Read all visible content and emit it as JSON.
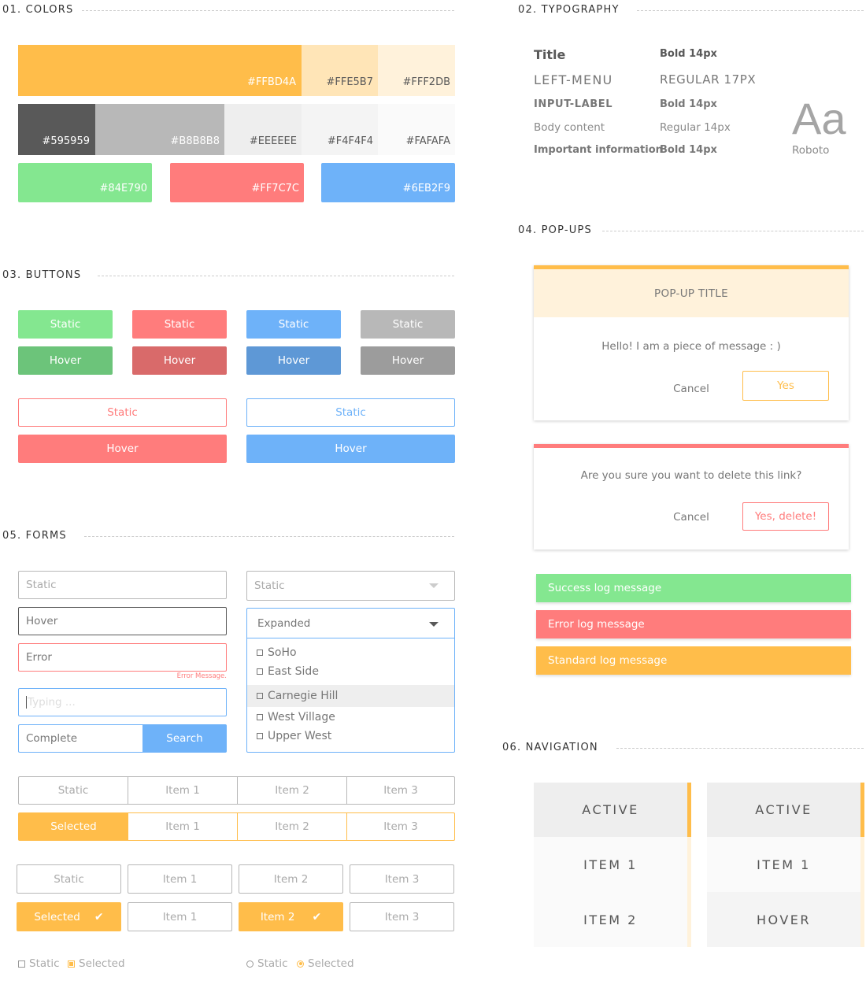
{
  "colors": {
    "title": "01. COLORS",
    "row1": [
      {
        "hex": "#FFBD4A",
        "label": "#FFBD4A"
      },
      {
        "hex": "#FFE5B7",
        "label": "#FFE5B7"
      },
      {
        "hex": "#FFF2DB",
        "label": "#FFF2DB"
      }
    ],
    "row2": [
      {
        "hex": "#595959",
        "label": "#595959"
      },
      {
        "hex": "#B8B8B8",
        "label": "#B8B8B8"
      },
      {
        "hex": "#EEEEEE",
        "label": "#EEEEEE"
      },
      {
        "hex": "#F4F4F4",
        "label": "#F4F4F4"
      },
      {
        "hex": "#FAFAFA",
        "label": "#FAFAFA"
      }
    ],
    "row3": [
      {
        "hex": "#84E790",
        "label": "#84E790"
      },
      {
        "hex": "#FF7C7C",
        "label": "#FF7C7C"
      },
      {
        "hex": "#6EB2F9",
        "label": "#6EB2F9"
      }
    ]
  },
  "typography": {
    "title": "02. TYPOGRAPHY",
    "rows": [
      {
        "name": "Title",
        "spec": "Bold 14px"
      },
      {
        "name": "LEFT-MENU",
        "spec": "REGULAR 17PX"
      },
      {
        "name": "INPUT-LABEL",
        "spec": "Bold 14px"
      },
      {
        "name": "Body content",
        "spec": "Regular 14px"
      },
      {
        "name": "Important information",
        "spec": "Bold 14px"
      }
    ],
    "sample": "Aa",
    "font_name": "Roboto"
  },
  "buttons": {
    "title": "03. BUTTONS",
    "static": "Static",
    "hover": "Hover"
  },
  "popups": {
    "title": "04. POP-UPS",
    "popup1": {
      "title": "POP-UP TITLE",
      "message": "Hello! I am a piece of message : )",
      "cancel": "Cancel",
      "confirm": "Yes"
    },
    "popup2": {
      "message": "Are you sure you want to delete this link?",
      "cancel": "Cancel",
      "confirm": "Yes, delete!"
    },
    "logs": {
      "success": "Success log message",
      "error": "Error log message",
      "standard": "Standard log message"
    }
  },
  "forms": {
    "title": "05. FORMS",
    "inputs": {
      "static": "Static",
      "hover": "Hover",
      "error": "Error",
      "error_message": "Error Message.",
      "typing_placeholder": "Typing ...",
      "complete": "Complete",
      "search": "Search"
    },
    "dropdown": {
      "static": "Static",
      "expanded": "Expanded",
      "options": [
        "SoHo",
        "East Side",
        "Carnegie Hill",
        "West Village",
        "Upper West"
      ]
    },
    "segmented": {
      "static": "Static",
      "selected": "Selected",
      "items": [
        "Item 1",
        "Item 2",
        "Item 3"
      ]
    },
    "toggles": {
      "static": "Static",
      "selected": "Selected",
      "item1": "Item 1",
      "item2": "Item 2",
      "item3": "Item 3"
    },
    "checkbox": {
      "static": "Static",
      "selected": "Selected"
    },
    "radio": {
      "static": "Static",
      "selected": "Selected"
    }
  },
  "navigation": {
    "title": "06. NAVIGATION",
    "menu1": [
      "ACTIVE",
      "ITEM 1",
      "ITEM 2"
    ],
    "menu2": [
      "ACTIVE",
      "ITEM 1",
      "HOVER"
    ]
  }
}
